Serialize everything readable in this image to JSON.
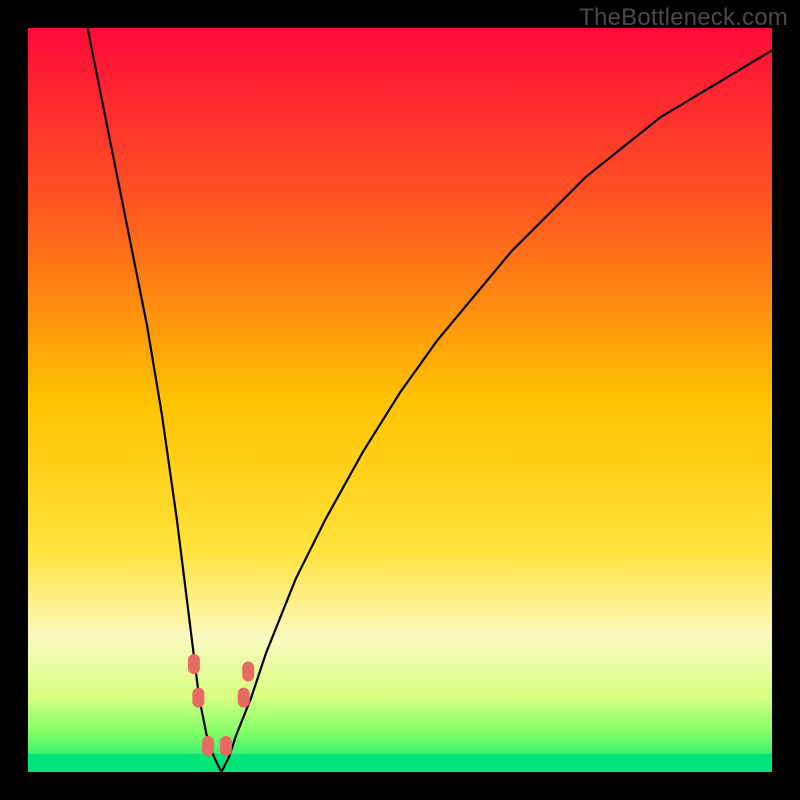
{
  "watermark": "TheBottleneck.com",
  "chart_data": {
    "type": "line",
    "title": "",
    "xlabel": "",
    "ylabel": "",
    "xlim": [
      0,
      100
    ],
    "ylim": [
      0,
      100
    ],
    "background": {
      "description": "vertical gradient, bottleneck severity color scale",
      "stops": [
        {
          "pos": 0.0,
          "color": "#ff0a3a"
        },
        {
          "pos": 0.25,
          "color": "#ff5a1f"
        },
        {
          "pos": 0.5,
          "color": "#ffc200"
        },
        {
          "pos": 0.7,
          "color": "#ffe23a"
        },
        {
          "pos": 0.82,
          "color": "#fbf9c0"
        },
        {
          "pos": 0.9,
          "color": "#d7ff80"
        },
        {
          "pos": 0.95,
          "color": "#7bff66"
        },
        {
          "pos": 1.0,
          "color": "#00e27a"
        }
      ]
    },
    "series": [
      {
        "name": "bottleneck-curve",
        "color": "#000000",
        "x": [
          8,
          10,
          12,
          14,
          16,
          18,
          20,
          21,
          22,
          23,
          24,
          25,
          26,
          27,
          28,
          30,
          32,
          36,
          40,
          45,
          50,
          55,
          60,
          65,
          70,
          75,
          80,
          85,
          90,
          95,
          100
        ],
        "y": [
          100,
          90,
          80,
          70,
          60,
          48,
          34,
          26,
          18,
          10,
          5,
          2,
          0,
          2,
          5,
          10,
          16,
          26,
          34,
          43,
          51,
          58,
          64,
          70,
          75,
          80,
          84,
          88,
          91,
          94,
          97
        ]
      }
    ],
    "markers": [
      {
        "name": "point-left-upper",
        "x": 22.3,
        "y": 14.5,
        "color": "#e76a63"
      },
      {
        "name": "point-left-lower",
        "x": 22.9,
        "y": 10.0,
        "color": "#e76a63"
      },
      {
        "name": "point-min-left",
        "x": 24.2,
        "y": 3.5,
        "color": "#e76a63"
      },
      {
        "name": "point-min-right",
        "x": 26.6,
        "y": 3.5,
        "color": "#e76a63"
      },
      {
        "name": "point-right-lower",
        "x": 29.0,
        "y": 10.0,
        "color": "#e76a63"
      },
      {
        "name": "point-right-upper",
        "x": 29.6,
        "y": 13.5,
        "color": "#e76a63"
      }
    ]
  }
}
